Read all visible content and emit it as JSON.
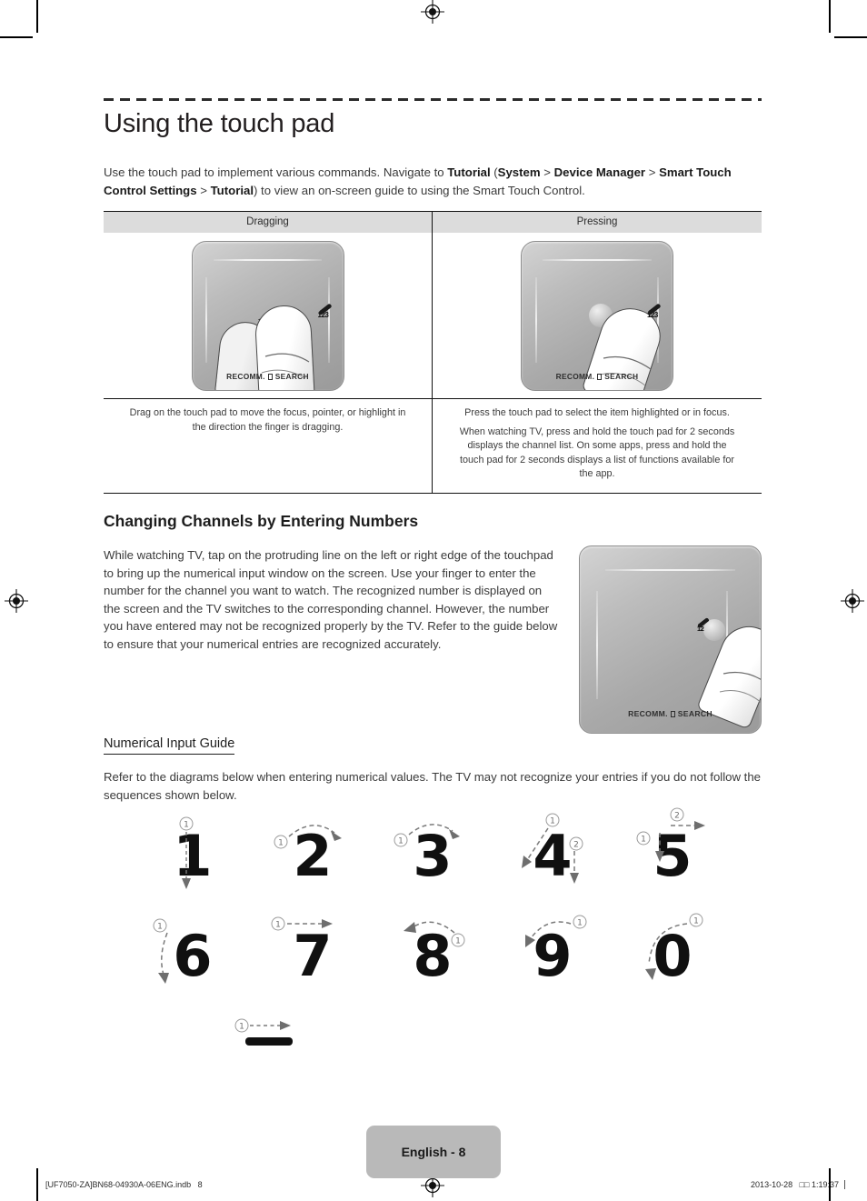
{
  "document": {
    "title": "Using the touch pad",
    "intro_parts": [
      {
        "t": "Use the touch pad to implement various commands. Navigate to ",
        "b": false
      },
      {
        "t": "Tutorial",
        "b": true
      },
      {
        "t": " (",
        "b": false
      },
      {
        "t": "System",
        "b": true
      },
      {
        "t": " > ",
        "b": false
      },
      {
        "t": "Device Manager",
        "b": true
      },
      {
        "t": " > ",
        "b": false
      },
      {
        "t": "Smart Touch Control Settings",
        "b": true
      },
      {
        "t": " > ",
        "b": false
      },
      {
        "t": "Tutorial",
        "b": true
      },
      {
        "t": ") to view an on-screen guide to using the Smart Touch Control.",
        "b": false
      }
    ]
  },
  "gesture_table": {
    "columns": [
      {
        "header": "Dragging",
        "illustration": "touchpad-dragging",
        "pad_label": "RECOMM.",
        "pad_label_2": "SEARCH",
        "pen_number": "123",
        "captions": [
          "Drag on the touch pad to move the focus, pointer, or highlight in the direction the finger is dragging."
        ]
      },
      {
        "header": "Pressing",
        "illustration": "touchpad-pressing",
        "pad_label": "RECOMM.",
        "pad_label_2": "SEARCH",
        "pen_number": "123",
        "captions": [
          "Press the touch pad to select the item highlighted or in focus.",
          "When watching TV, press and hold the touch pad for 2 seconds displays the channel list. On some apps, press and hold the touch pad for 2 seconds displays a list of functions available for the app."
        ]
      }
    ]
  },
  "channels_section": {
    "heading": "Changing Channels by Entering Numbers",
    "body": "While watching TV, tap on the protruding line on the left or right edge of the touchpad to bring up the numerical input window on the screen. Use your finger to enter the number for the channel you want to watch. The recognized number is displayed on the screen and the TV switches to the corresponding channel. However, the number you have entered may not be recognized properly by the TV. Refer to the guide below to ensure that your numerical entries are recognized accurately.",
    "illustration": "touchpad-edge-tap",
    "pad_label": "RECOMM.",
    "pad_label_2": "SEARCH",
    "pen_number": "12"
  },
  "numerical_guide": {
    "heading": "Numerical Input Guide",
    "body": "Refer to the diagrams below when entering numerical values. The TV may not recognize your entries if you do not follow the sequences shown below.",
    "rows": [
      [
        {
          "glyph": "1",
          "strokes": [
            "①"
          ]
        },
        {
          "glyph": "2",
          "strokes": [
            "①"
          ]
        },
        {
          "glyph": "3",
          "strokes": [
            "①"
          ]
        },
        {
          "glyph": "4",
          "strokes": [
            "①",
            "②"
          ]
        },
        {
          "glyph": "5",
          "strokes": [
            "①",
            "②"
          ]
        }
      ],
      [
        {
          "glyph": "6",
          "strokes": [
            "①"
          ]
        },
        {
          "glyph": "7",
          "strokes": [
            "①"
          ]
        },
        {
          "glyph": "8",
          "strokes": [
            "①"
          ]
        },
        {
          "glyph": "9",
          "strokes": [
            "①"
          ]
        },
        {
          "glyph": "0",
          "strokes": [
            "①"
          ]
        }
      ]
    ],
    "dash_row": [
      {
        "glyph": "-",
        "strokes": [
          "①"
        ]
      }
    ]
  },
  "footer": {
    "page_badge": "English - 8",
    "file_ref": "[UF7050-ZA]BN68-04930A-06ENG.indb   8",
    "timestamp": "2013-10-28   □□ 1:19:37"
  },
  "colors": {
    "text": "#231f20",
    "header_fill": "#dcdcdc",
    "badge_fill": "#b9b9b9",
    "rule": "#111111"
  }
}
